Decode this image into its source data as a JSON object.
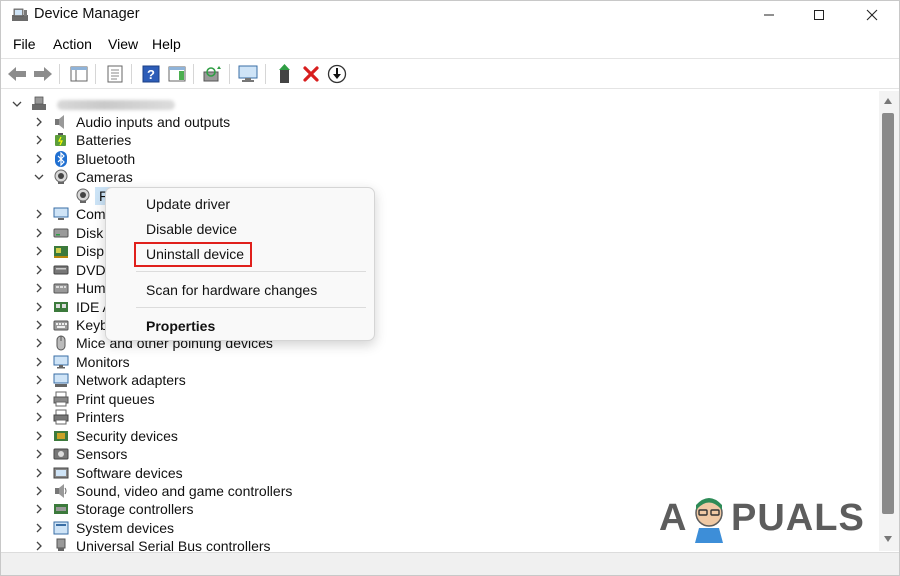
{
  "window": {
    "title": "Device Manager"
  },
  "menu": [
    "File",
    "Action",
    "View",
    "Help"
  ],
  "tree": {
    "root_name_blurred": "",
    "categories": [
      {
        "label": "Audio inputs and outputs",
        "icon": "speaker-icon",
        "expanded": false
      },
      {
        "label": "Batteries",
        "icon": "battery-icon",
        "expanded": false
      },
      {
        "label": "Bluetooth",
        "icon": "bluetooth-icon",
        "expanded": false
      },
      {
        "label": "Cameras",
        "icon": "camera-icon",
        "expanded": true
      },
      {
        "label": "F",
        "icon": "webcam-icon",
        "child": true,
        "selected": true
      },
      {
        "label": "Com",
        "icon": "computer-icon",
        "expanded": false
      },
      {
        "label": "Disk",
        "icon": "disk-drive-icon",
        "expanded": false
      },
      {
        "label": "Disp",
        "icon": "display-adapter-icon",
        "expanded": false
      },
      {
        "label": "DVD",
        "icon": "dvd-drive-icon",
        "expanded": false
      },
      {
        "label": "Hum",
        "icon": "hid-icon",
        "expanded": false
      },
      {
        "label": "IDE A",
        "icon": "ide-controller-icon",
        "expanded": false
      },
      {
        "label": "Keyb",
        "icon": "keyboard-icon",
        "expanded": false
      },
      {
        "label": "Mice and other pointing devices",
        "icon": "mouse-icon",
        "expanded": false
      },
      {
        "label": "Monitors",
        "icon": "monitor-icon",
        "expanded": false
      },
      {
        "label": "Network adapters",
        "icon": "network-adapter-icon",
        "expanded": false
      },
      {
        "label": "Print queues",
        "icon": "print-queue-icon",
        "expanded": false
      },
      {
        "label": "Printers",
        "icon": "printer-icon",
        "expanded": false
      },
      {
        "label": "Security devices",
        "icon": "security-device-icon",
        "expanded": false
      },
      {
        "label": "Sensors",
        "icon": "sensor-icon",
        "expanded": false
      },
      {
        "label": "Software devices",
        "icon": "software-device-icon",
        "expanded": false
      },
      {
        "label": "Sound, video and game controllers",
        "icon": "sound-controller-icon",
        "expanded": false
      },
      {
        "label": "Storage controllers",
        "icon": "storage-controller-icon",
        "expanded": false
      },
      {
        "label": "System devices",
        "icon": "system-device-icon",
        "expanded": false
      },
      {
        "label": "Universal Serial Bus controllers",
        "icon": "usb-icon",
        "expanded": false
      }
    ]
  },
  "context_menu": {
    "items": [
      {
        "label": "Update driver"
      },
      {
        "label": "Disable device"
      },
      {
        "label": "Uninstall device",
        "highlighted": true
      },
      {
        "label": "Scan for hardware changes"
      },
      {
        "label": "Properties",
        "bold": true
      }
    ],
    "highlight_color": "#e0201c"
  },
  "watermark": {
    "text_left": "A",
    "text_right": "PUALS"
  },
  "colors": {
    "accent_blue": "#1f6fd1",
    "delete_red": "#d81e1e",
    "install_green": "#2f9e44"
  }
}
